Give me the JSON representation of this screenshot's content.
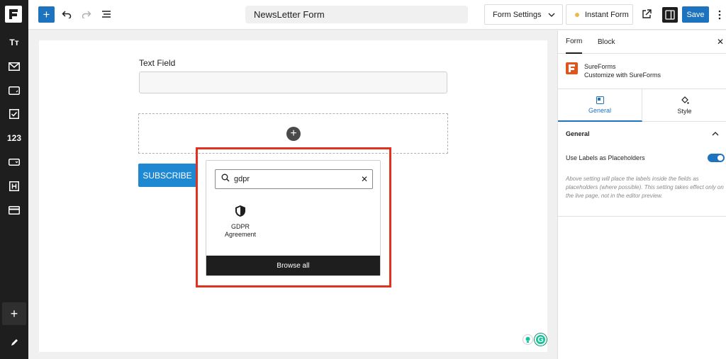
{
  "app": {
    "title": "NewsLetter Form",
    "accent_color": "#1e73be",
    "brand_color": "#e2541c"
  },
  "toolbar": {
    "add_label": "+",
    "form_settings_label": "Form Settings",
    "instant_form_label": "Instant Form",
    "save_label": "Save",
    "icons": [
      "plus-icon",
      "undo-icon",
      "redo-icon",
      "list-view-icon",
      "external-link-icon",
      "sidebar-toggle-icon",
      "kebab-icon"
    ]
  },
  "leftbar": {
    "items": [
      {
        "icon": "typography-icon",
        "label": "Tт"
      },
      {
        "icon": "mail-icon",
        "label": ""
      },
      {
        "icon": "textarea-icon",
        "label": ""
      },
      {
        "icon": "checkbox-icon",
        "label": ""
      },
      {
        "icon": "number-icon",
        "label": "123"
      },
      {
        "icon": "dropdown-icon",
        "label": ""
      },
      {
        "icon": "heading-icon",
        "label": ""
      },
      {
        "icon": "card-icon",
        "label": ""
      }
    ],
    "add_label": "+"
  },
  "canvas": {
    "field_label": "Text Field",
    "subscribe_label": "SUBSCRIBE"
  },
  "inserter": {
    "search_value": "gdpr",
    "result_label": "GDPR Agreement",
    "browse_all_label": "Browse all"
  },
  "right_panel": {
    "tabs": [
      "Form",
      "Block"
    ],
    "brand_name": "SureForms",
    "brand_subtitle": "Customize with SureForms",
    "subtabs": [
      "General",
      "Style"
    ],
    "section_title": "General",
    "toggle_label": "Use Labels as Placeholders",
    "toggle_on": true,
    "help_text": "Above setting will place the labels inside the fields as placeholders (where possible). This setting takes effect only on the live page, not in the editor preview."
  }
}
